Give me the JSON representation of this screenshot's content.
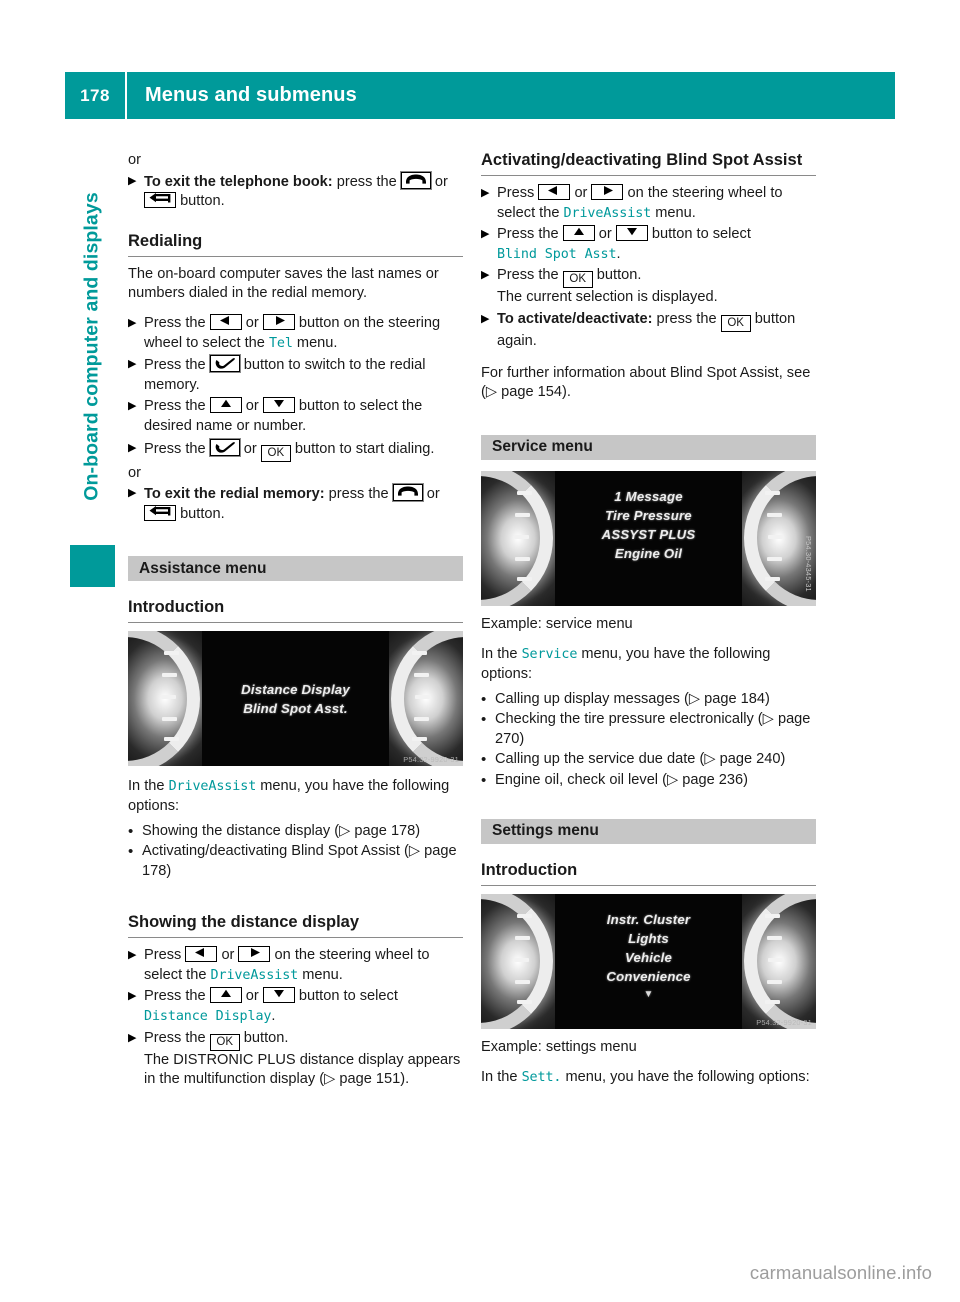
{
  "header": {
    "page_number": "178",
    "title": "Menus and submenus"
  },
  "side_tab": {
    "label": "On-board computer and displays"
  },
  "watermark": "carmanualsonline.info",
  "icons": {
    "hangup": "phone-hangup-icon",
    "back": "back-arrow-icon",
    "left": "arrow-left-icon",
    "right": "arrow-right-icon",
    "up": "arrow-up-icon",
    "down": "arrow-down-icon",
    "call": "phone-call-icon",
    "ok": "OK"
  },
  "colors": {
    "accent_teal": "#009A9A",
    "mono_teal": "#00999B",
    "band_gray": "#c6c6c6",
    "rule_gray": "#8a8a8a"
  },
  "left_column": {
    "or_1": "or",
    "exit_phonebook": {
      "bold": "To exit the telephone book:",
      "t1": "press the",
      "t2": "or",
      "t3": "button."
    },
    "redialing": {
      "heading": "Redialing",
      "intro": "The on-board computer saves the last names or numbers dialed in the redial memory.",
      "step1": {
        "t1": "Press the",
        "t2": "or",
        "t3": "button on the steering wheel to select the",
        "menu": "Tel",
        "t4": "menu."
      },
      "step2": {
        "t1": "Press the",
        "t2": "button to switch to the redial memory."
      },
      "step3": {
        "t1": "Press the",
        "t2": "or",
        "t3": "button to select the desired name or number."
      },
      "step4": {
        "t1": "Press the",
        "t2": "or",
        "t3": "button to start dialing."
      },
      "or_2": "or",
      "exit_redial": {
        "bold": "To exit the redial memory:",
        "t1": "press the",
        "t2": "or",
        "t3": "button."
      }
    },
    "assistance_band": "Assistance menu",
    "introduction_heading": "Introduction",
    "figure1": {
      "lines": [
        "Distance Display",
        "Blind Spot Asst."
      ],
      "code": "P54.32-9920-31"
    },
    "driveassist_intro": {
      "t1": "In the",
      "menu": "DriveAssist",
      "t2": "menu, you have the following options:"
    },
    "driveassist_options": [
      {
        "text": "Showing the distance display (",
        "ref": "page 178",
        "close": ")"
      },
      {
        "text": "Activating/deactivating Blind Spot Assist (",
        "ref": "page 178",
        "close": ")"
      }
    ],
    "showing_distance": {
      "heading": "Showing the distance display",
      "step1": {
        "t1": "Press",
        "t2": "or",
        "t3": "on the steering wheel to select the",
        "menu": "DriveAssist",
        "t4": "menu."
      },
      "step2": {
        "t1": "Press the",
        "t2": "or",
        "t3": "button to select",
        "menu": "Distance Display",
        "t4": "."
      },
      "step3": {
        "t1": "Press the",
        "t2": "button.",
        "t3": "The DISTRONIC PLUS distance display appears in the multifunction display (",
        "ref": "page 151",
        "close": ")."
      }
    }
  },
  "right_column": {
    "blindspot": {
      "heading": "Activating/deactivating Blind Spot Assist",
      "step1": {
        "t1": "Press",
        "t2": "or",
        "t3": "on the steering wheel to select the",
        "menu": "DriveAssist",
        "t4": "menu."
      },
      "step2": {
        "t1": "Press the",
        "t2": "or",
        "t3": "button to select",
        "menu": "Blind Spot Asst",
        "t4": "."
      },
      "step3": {
        "t1": "Press the",
        "t2": "button.",
        "t3": "The current selection is displayed."
      },
      "step4": {
        "bold": "To activate/deactivate:",
        "t1": "press the",
        "t2": "button again."
      },
      "footer": {
        "t1": "For further information about Blind Spot Assist, see (",
        "ref": "page 154",
        "close": ")."
      }
    },
    "service_band": "Service menu",
    "figure2": {
      "lines": [
        "1 Message",
        "Tire Pressure",
        "ASSYST PLUS",
        "Engine Oil"
      ],
      "code": "P54.30-4345-31"
    },
    "figure2_caption": "Example: service menu",
    "service_intro": {
      "t1": "In the",
      "menu": "Service",
      "t2": "menu, you have the following options:"
    },
    "service_options": [
      {
        "text": "Calling up display messages (",
        "ref": "page 184",
        "close": ")"
      },
      {
        "text": "Checking the tire pressure electronically (",
        "ref": "page 270",
        "close": ")"
      },
      {
        "text": "Calling up the service due date (",
        "ref": "page 240",
        "close": ")"
      },
      {
        "text": "Engine oil, check oil level (",
        "ref": "page 236",
        "close": ")"
      }
    ],
    "settings_band": "Settings menu",
    "settings_intro_heading": "Introduction",
    "figure3": {
      "lines": [
        "Instr. Cluster",
        "Lights",
        "Vehicle",
        "Convenience"
      ],
      "caret": "▼",
      "code": "P54.32-9920-31"
    },
    "figure3_caption": "Example: settings menu",
    "settings_intro": {
      "t1": "In the",
      "menu": "Sett.",
      "t2": "menu, you have the following options:"
    }
  }
}
